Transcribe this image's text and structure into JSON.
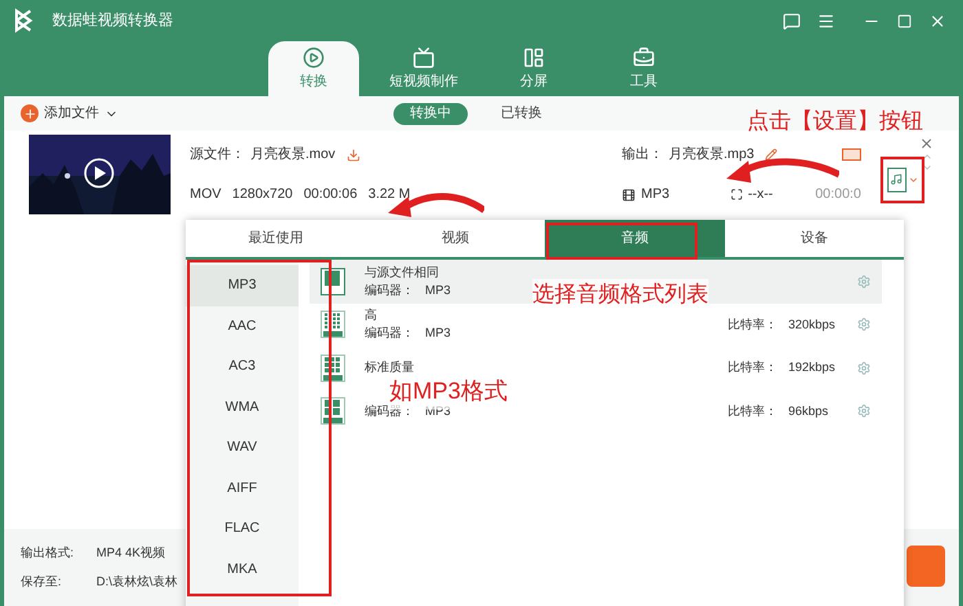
{
  "window": {
    "title": "数据蛙视频转换器"
  },
  "main_tabs": [
    {
      "label": "转换",
      "kind": "convert",
      "selected": true
    },
    {
      "label": "短视频制作",
      "kind": "tv",
      "selected": false
    },
    {
      "label": "分屏",
      "kind": "split",
      "selected": false
    },
    {
      "label": "工具",
      "kind": "toolbox",
      "selected": false
    }
  ],
  "toolbar": {
    "add_file": "添加文件",
    "segments": [
      {
        "label": "转换中",
        "selected": true
      },
      {
        "label": "已转换",
        "selected": false
      }
    ]
  },
  "file": {
    "source_label": "源文件：",
    "source_name": "月亮夜景.mov",
    "output_label": "输出：",
    "output_name": "月亮夜景.mp3",
    "source_format": "MOV",
    "resolution": "1280x720",
    "duration": "00:00:06",
    "size": "3.22 M",
    "output_format": "MP3",
    "output_resolution": "--x--",
    "output_duration": "00:00:0"
  },
  "format_popup": {
    "tabs": [
      {
        "label": "最近使用",
        "selected": false
      },
      {
        "label": "视频",
        "selected": false
      },
      {
        "label": "音频",
        "selected": true
      },
      {
        "label": "设备",
        "selected": false
      }
    ],
    "categories": [
      {
        "label": "MP3",
        "selected": true
      },
      {
        "label": "AAC",
        "selected": false
      },
      {
        "label": "AC3",
        "selected": false
      },
      {
        "label": "WMA",
        "selected": false
      },
      {
        "label": "WAV",
        "selected": false
      },
      {
        "label": "AIFF",
        "selected": false
      },
      {
        "label": "FLAC",
        "selected": false
      },
      {
        "label": "MKA",
        "selected": false
      }
    ],
    "presets": [
      {
        "name": "与源文件相同",
        "kind": "same",
        "encoder_label": "编码器：",
        "encoder": "MP3",
        "selected": true
      },
      {
        "name": "高",
        "kind": "high",
        "encoder_label": "编码器：",
        "encoder": "MP3",
        "bitrate_label": "比特率：",
        "bitrate": "320kbps",
        "selected": false
      },
      {
        "name": "标准质量",
        "kind": "medium",
        "bitrate_label": "比特率：",
        "bitrate": "192kbps",
        "selected": false
      },
      {
        "kind": "low",
        "encoder_label": "编码器：",
        "encoder": "MP3",
        "bitrate_label": "比特率：",
        "bitrate": "96kbps",
        "selected": false
      }
    ]
  },
  "bottom": {
    "output_format_label": "输出格式:",
    "output_format": "MP4 4K视频",
    "save_label": "保存至:",
    "save_path": "D:\\袁林炫\\袁林"
  },
  "annotations": [
    "点击【设置】按钮",
    "选择音频格式列表",
    "如MP3格式"
  ]
}
